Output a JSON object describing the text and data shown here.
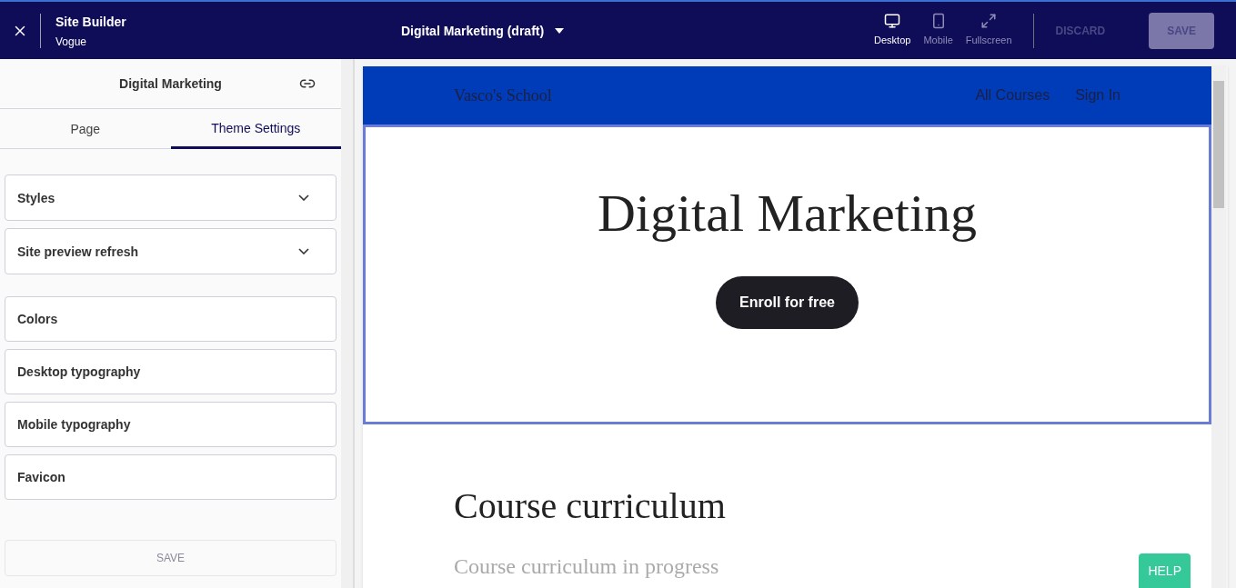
{
  "app": {
    "title": "Site Builder",
    "subtitle": "Vogue"
  },
  "page_selector": {
    "label": "Digital Marketing (draft)"
  },
  "devices": [
    {
      "label": "Desktop",
      "kind": "desktop",
      "selected": true
    },
    {
      "label": "Mobile",
      "kind": "mobile",
      "selected": false
    },
    {
      "label": "Fullscreen",
      "kind": "fullscreen",
      "selected": false
    }
  ],
  "actions": [
    {
      "label": "DISCARD",
      "kind": "text",
      "disabled": true
    },
    {
      "label": "SAVE",
      "kind": "filled",
      "disabled": true
    }
  ],
  "sidebar": {
    "title": "Digital Marketing",
    "tabs": [
      {
        "label": "Page",
        "selected": false
      },
      {
        "label": "Theme Settings",
        "selected": true
      }
    ],
    "groups": [
      [
        {
          "label": "Styles",
          "kind": "accordion",
          "expanded": false
        },
        {
          "label": "Site preview refresh",
          "kind": "accordion",
          "expanded": false
        }
      ],
      [
        {
          "label": "Colors",
          "kind": "link"
        },
        {
          "label": "Desktop typography",
          "kind": "link"
        },
        {
          "label": "Mobile typography",
          "kind": "link"
        },
        {
          "label": "Favicon",
          "kind": "link"
        }
      ]
    ],
    "save": {
      "label": "SAVE",
      "disabled": true
    }
  },
  "preview": {
    "school": "Vasco's School",
    "nav": [
      "All Courses",
      "Sign In"
    ],
    "hero_title": "Digital Marketing",
    "hero_button": "Enroll for free",
    "section_title": "Course curriculum",
    "section_text": "Course curriculum in progress"
  },
  "help": "HELP"
}
